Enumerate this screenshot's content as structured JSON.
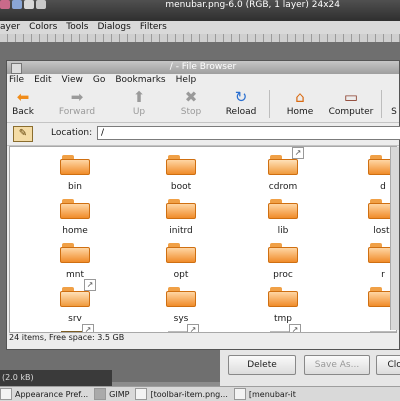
{
  "gimp": {
    "title": "menubar.png-6.0 (RGB, 1 layer) 24x24",
    "menu": [
      "ayer",
      "Colors",
      "Tools",
      "Dialogs",
      "Filters"
    ],
    "status": "(2.0 kB)"
  },
  "bg_dialog": {
    "buttons": [
      "Delete",
      "Save As...",
      "Clos"
    ]
  },
  "file_browser": {
    "title": "/ - File Browser",
    "menu": [
      "File",
      "Edit",
      "View",
      "Go",
      "Bookmarks",
      "Help"
    ],
    "toolbar": [
      {
        "label": "Back",
        "icon": "back-arrow-icon",
        "enabled": true
      },
      {
        "label": "Forward",
        "icon": "forward-arrow-icon",
        "enabled": false
      },
      {
        "label": "Up",
        "icon": "up-arrow-icon",
        "enabled": false
      },
      {
        "label": "Stop",
        "icon": "stop-icon",
        "enabled": false
      },
      {
        "label": "Reload",
        "icon": "reload-icon",
        "enabled": true
      },
      {
        "label": "Home",
        "icon": "home-icon",
        "enabled": true
      },
      {
        "label": "Computer",
        "icon": "computer-icon",
        "enabled": true
      },
      {
        "label": "S",
        "icon": "search-icon",
        "enabled": true
      }
    ],
    "location": {
      "label": "Location:",
      "value": "/"
    },
    "files": [
      {
        "name": "bin",
        "kind": "folder"
      },
      {
        "name": "boot",
        "kind": "folder"
      },
      {
        "name": "cdrom",
        "kind": "folder-link"
      },
      {
        "name": "d",
        "kind": "folder"
      },
      {
        "name": "home",
        "kind": "folder"
      },
      {
        "name": "initrd",
        "kind": "folder"
      },
      {
        "name": "lib",
        "kind": "folder"
      },
      {
        "name": "lost-",
        "kind": "folder"
      },
      {
        "name": "mnt",
        "kind": "folder"
      },
      {
        "name": "opt",
        "kind": "folder"
      },
      {
        "name": "proc",
        "kind": "folder"
      },
      {
        "name": "r",
        "kind": "folder"
      },
      {
        "name": "srv",
        "kind": "folder-link"
      },
      {
        "name": "sys",
        "kind": "folder"
      },
      {
        "name": "tmp",
        "kind": "folder"
      },
      {
        "name": "",
        "kind": "folder"
      },
      {
        "name": "",
        "kind": "brown-link"
      },
      {
        "name": "",
        "kind": "doc-link"
      },
      {
        "name": "",
        "kind": "doc-link"
      },
      {
        "name": "",
        "kind": "doc"
      }
    ],
    "status": "24 items, Free space: 3.5 GB"
  },
  "taskbar": {
    "items": [
      "Appearance Pref...",
      "GIMP",
      "[toolbar-item.png...",
      "[menubar-it"
    ]
  }
}
